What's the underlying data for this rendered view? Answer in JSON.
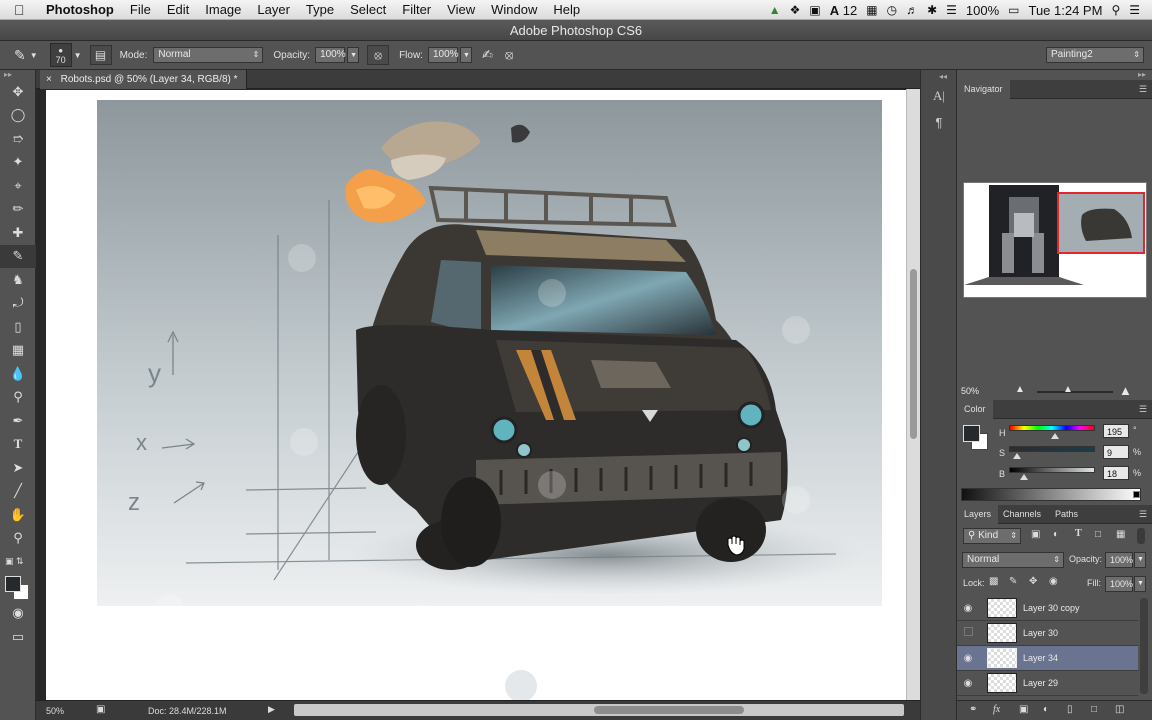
{
  "menubar": {
    "apple": "",
    "app_name": "Photoshop",
    "items": [
      "File",
      "Edit",
      "Image",
      "Layer",
      "Type",
      "Select",
      "Filter",
      "View",
      "Window",
      "Help"
    ],
    "status": {
      "adobe_number": "12",
      "battery": "100%",
      "clock": "Tue 1:24 PM"
    }
  },
  "window": {
    "title": "Adobe Photoshop CS6"
  },
  "options": {
    "brush_size": "70",
    "mode_label": "Mode:",
    "mode_value": "Normal",
    "opacity_label": "Opacity:",
    "opacity_value": "100%",
    "flow_label": "Flow:",
    "flow_value": "100%",
    "workspace": "Painting2"
  },
  "document": {
    "tab_close": "×",
    "tab_title": "Robots.psd @ 50% (Layer 34, RGB/8) *",
    "sketch_labels": {
      "y": "y",
      "x": "x",
      "z": "z"
    }
  },
  "statusbar": {
    "zoom": "50%",
    "doc_info": "Doc: 28.4M/228.1M"
  },
  "navigator": {
    "tab": "Navigator",
    "zoom": "50%"
  },
  "color": {
    "tab": "Color",
    "h_label": "H",
    "h_value": "195",
    "h_unit": "°",
    "s_label": "S",
    "s_value": "9",
    "s_unit": "%",
    "b_label": "B",
    "b_value": "18",
    "b_unit": "%",
    "h_fraction": 0.54,
    "s_fraction": 0.09,
    "b_fraction": 0.18,
    "foreground": "#272a2d",
    "background": "#ffffff"
  },
  "layers": {
    "tabs": [
      "Layers",
      "Channels",
      "Paths"
    ],
    "filter_label": "Kind",
    "blend_mode": "Normal",
    "opacity_label": "Opacity:",
    "opacity_value": "100%",
    "lock_label": "Lock:",
    "fill_label": "Fill:",
    "fill_value": "100%",
    "rows": [
      {
        "name": "Layer 30 copy",
        "visible": true,
        "selected": false
      },
      {
        "name": "Layer 30",
        "visible": false,
        "selected": false
      },
      {
        "name": "Layer 34",
        "visible": true,
        "selected": true
      },
      {
        "name": "Layer 29",
        "visible": true,
        "selected": false
      }
    ]
  },
  "colors": {
    "selection": "#6a7390",
    "accent_red": "#e0262e"
  }
}
